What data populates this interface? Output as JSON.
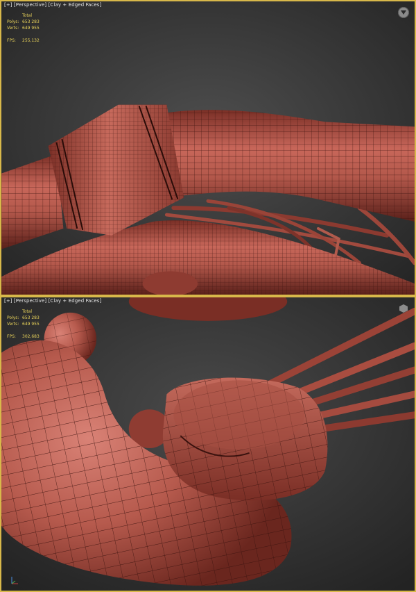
{
  "viewport_top": {
    "label": "[+] [Perspective] [Clay + Edged Faces]",
    "stats": {
      "header": "Total",
      "polys_label": "Polys:",
      "polys": "653 283",
      "verts_label": "Verts:",
      "verts": "649 955",
      "fps_label": "FPS:",
      "fps": "255,132"
    }
  },
  "viewport_bottom": {
    "label": "[+] [Perspective] [Clay + Edged Faces]",
    "stats": {
      "header": "Total",
      "polys_label": "Polys:",
      "polys": "653 283",
      "verts_label": "Verts:",
      "verts": "649 955",
      "fps_label": "FPS:",
      "fps": "302,683"
    }
  },
  "colors": {
    "clay": "#b85a4c",
    "clay_dark": "#6e2a22",
    "wire": "#3a120e",
    "stats": "#e8d25a",
    "border_active": "#d8b84a"
  }
}
